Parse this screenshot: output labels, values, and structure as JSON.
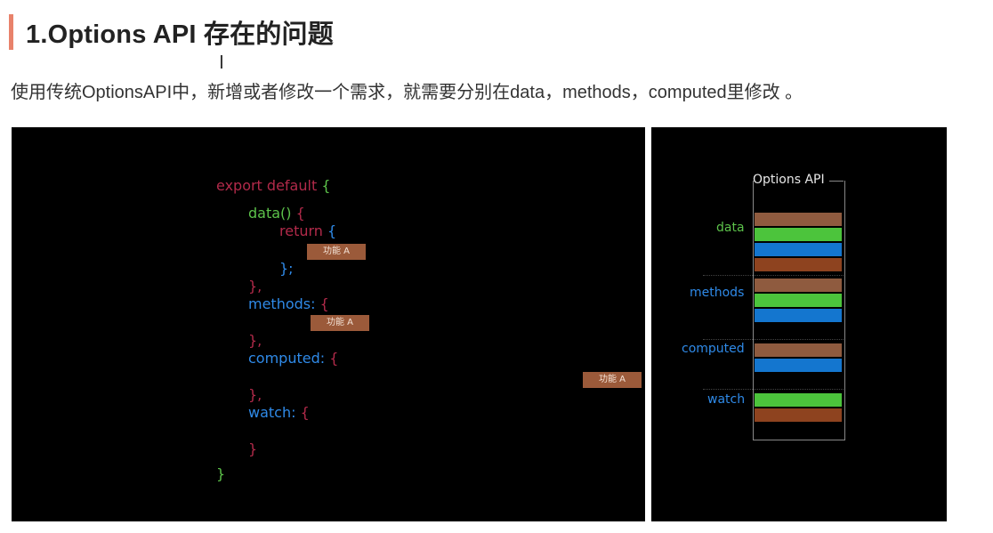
{
  "heading": "1.Options API 存在的问题",
  "cursor_glyph": "I",
  "paragraph": "使用传统OptionsAPI中，新增或者修改一个需求，就需要分别在data，methods，computed里修改 。",
  "code": {
    "export_line": "export default",
    "open_brace": "{",
    "data_fn": "data()",
    "data_brace": "{",
    "return_kw": "return",
    "return_brace": "{",
    "return_close": "};",
    "data_close": "},",
    "methods_key": "methods:",
    "methods_brace": "{",
    "methods_close": "},",
    "computed_key": "computed:",
    "computed_brace": "{",
    "computed_close": "},",
    "watch_key": "watch:",
    "watch_brace": "{",
    "watch_close": "}",
    "final_close": "}"
  },
  "feature_tags": [
    "功能 A",
    "功能 A",
    "功能 A"
  ],
  "options_diagram": {
    "title": "Options API",
    "categories": [
      "data",
      "methods",
      "computed",
      "watch"
    ],
    "colors": {
      "brown_light": "#8f5b3f",
      "green": "#4cc43c",
      "blue": "#1476cf",
      "brown_dark": "#8e431f"
    }
  }
}
